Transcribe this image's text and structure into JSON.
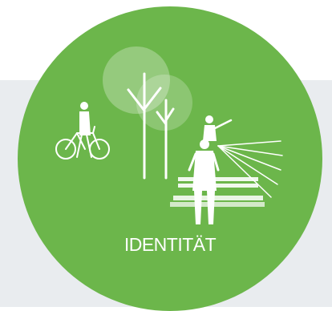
{
  "theme": {
    "circle_color": "#6cb64b",
    "band_color": "#e9ecef",
    "line_color": "#ffffff"
  },
  "icons": [
    "tree-icon",
    "cyclist-icon",
    "father-child-icon",
    "bench-icon",
    "sight-rays-icon"
  ],
  "caption": "IDENTITÄT"
}
